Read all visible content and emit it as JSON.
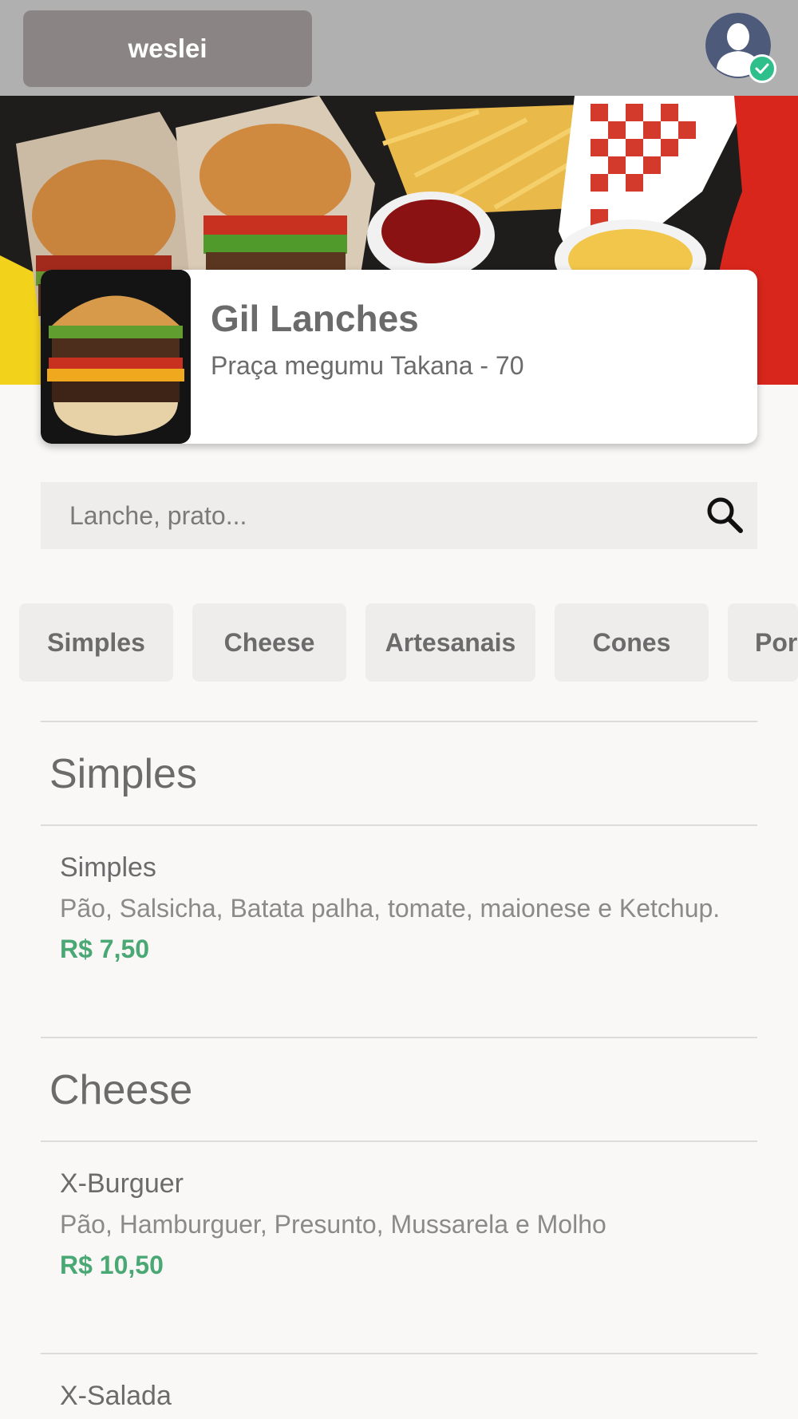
{
  "header": {
    "username": "weslei",
    "avatar_icon": "user-avatar-icon",
    "verified_icon": "check-icon",
    "verified_color": "#2fbf8a"
  },
  "restaurant": {
    "name": "Gil Lanches",
    "address": "Praça megumu Takana - 70"
  },
  "search": {
    "placeholder": "Lanche, prato...",
    "value": ""
  },
  "categories": [
    {
      "label": "Simples"
    },
    {
      "label": "Cheese"
    },
    {
      "label": "Artesanais"
    },
    {
      "label": "Cones"
    },
    {
      "label": "Por"
    }
  ],
  "sections": [
    {
      "title": "Simples",
      "items": [
        {
          "name": "Simples",
          "description": "Pão, Salsicha, Batata palha, tomate, maionese e Ketchup.",
          "price": "R$ 7,50"
        }
      ]
    },
    {
      "title": "Cheese",
      "items": [
        {
          "name": "X-Burguer",
          "description": "Pão, Hamburguer, Presunto, Mussarela e Molho",
          "price": "R$ 10,50"
        },
        {
          "name": "X-Salada"
        }
      ]
    }
  ],
  "colors": {
    "topbar": "#b0b0b0",
    "user_button": "#8a8584",
    "price": "#4aa874",
    "background": "#f9f8f7"
  }
}
